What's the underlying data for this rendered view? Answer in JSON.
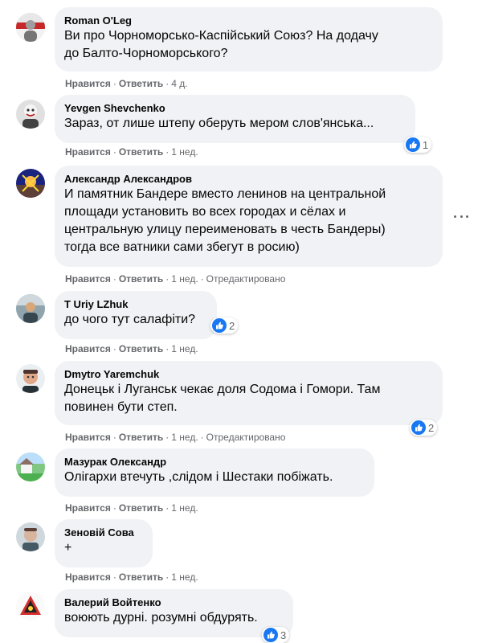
{
  "comments": [
    {
      "author": "Roman O'Leg",
      "lines": [
        "Ви про Чорноморсько-Каспійський Союз? На додачу",
        "до Балто-Чорноморського?"
      ],
      "like": "Нравится",
      "reply": "Ответить",
      "time": "4 д.",
      "edited": null,
      "reactions": null,
      "avatar_icon": "user-avatar-icon"
    },
    {
      "author": "Yevgen Shevchenko",
      "lines": [
        "Зараз, от лише штепу оберуть мером слов'янська..."
      ],
      "like": "Нравится",
      "reply": "Ответить",
      "time": "1 нед.",
      "edited": null,
      "reactions": "1",
      "avatar_icon": "user-avatar-icon"
    },
    {
      "author": "Александр Александров",
      "lines": [
        "И памятник Бандере вместо ленинов на центральной",
        "площади установить во всех городах и сёлах и",
        "центральную улицу переименовать в честь Бандеры)",
        "тогда все ватники сами збегут в росию)"
      ],
      "like": "Нравится",
      "reply": "Ответить",
      "time": "1 нед.",
      "edited": "Отредактировано",
      "reactions": null,
      "avatar_icon": "user-avatar-icon"
    },
    {
      "author": "T Uriy LZhuk",
      "lines": [
        "до чого тут салафіти?"
      ],
      "like": "Нравится",
      "reply": "Ответить",
      "time": "1 нед.",
      "edited": null,
      "reactions": "2",
      "avatar_icon": "user-avatar-icon"
    },
    {
      "author": "Dmytro Yaremchuk",
      "lines": [
        "Донецьк і Луганськ чекає доля Содома і Гомори. Там",
        "повинен бути степ."
      ],
      "like": "Нравится",
      "reply": "Ответить",
      "time": "1 нед.",
      "edited": "Отредактировано",
      "reactions": "2",
      "avatar_icon": "user-avatar-icon"
    },
    {
      "author": "Мазурак Олександр",
      "lines": [
        "Олігархи втечуть ,слідом і Шестаки побіжать."
      ],
      "like": "Нравится",
      "reply": "Ответить",
      "time": "1 нед.",
      "edited": null,
      "reactions": null,
      "avatar_icon": "user-avatar-icon"
    },
    {
      "author": "Зеновій Сова",
      "lines": [
        "+"
      ],
      "like": "Нравится",
      "reply": "Ответить",
      "time": "1 нед.",
      "edited": null,
      "reactions": null,
      "avatar_icon": "user-avatar-icon"
    },
    {
      "author": "Валерий Войтенко",
      "lines": [
        "воюють дурні. розумні обдурять."
      ],
      "like": null,
      "reply": null,
      "time": null,
      "edited": null,
      "reactions": "3",
      "avatar_icon": "user-avatar-icon"
    }
  ],
  "colors": {
    "bubble": "#f0f2f5",
    "meta": "#65676b",
    "like_blue": "#1877f2"
  },
  "icons": {
    "like": "like-thumb-icon",
    "more": "more-options-icon"
  }
}
